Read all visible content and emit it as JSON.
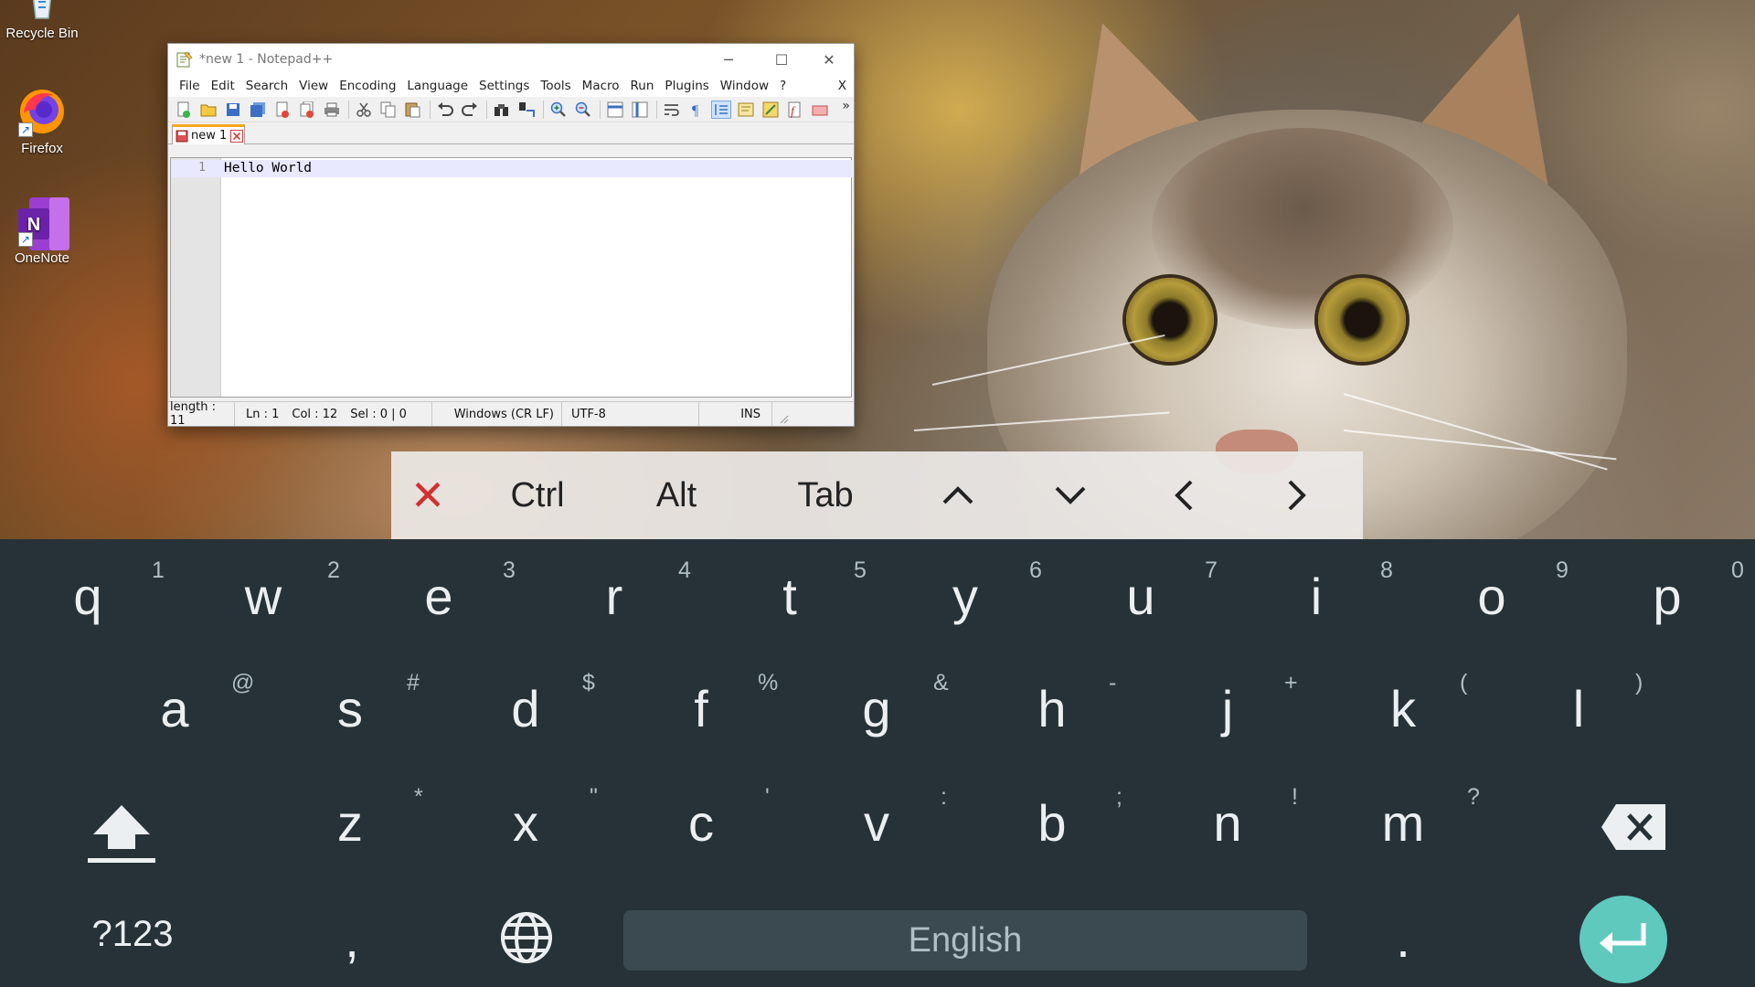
{
  "desktop": {
    "icons": [
      {
        "label": "Recycle Bin",
        "icon": "recycle-bin-icon"
      },
      {
        "label": "Firefox",
        "icon": "firefox-icon"
      },
      {
        "label": "OneNote",
        "icon": "onenote-icon"
      }
    ]
  },
  "notepad": {
    "title": "*new 1 - Notepad++",
    "window_controls": {
      "minimize": "─",
      "maximize": "☐",
      "close": "✕"
    },
    "menu": [
      "File",
      "Edit",
      "Search",
      "View",
      "Encoding",
      "Language",
      "Settings",
      "Tools",
      "Macro",
      "Run",
      "Plugins",
      "Window",
      "?"
    ],
    "menu_close": "X",
    "toolbar_overflow": "»",
    "tab": {
      "label": "new 1"
    },
    "editor": {
      "line_number": "1",
      "text": "Hello World"
    },
    "status": {
      "length": "length : 11",
      "ln": "Ln : 1",
      "col": "Col : 12",
      "sel": "Sel : 0 | 0",
      "eol": "Windows (CR LF)",
      "encoding": "UTF-8",
      "mode": "INS"
    }
  },
  "extra_keys": {
    "close_glyph": "✕",
    "ctrl": "Ctrl",
    "alt": "Alt",
    "tab": "Tab",
    "up": "up-arrow-icon",
    "down": "down-arrow-icon",
    "left": "left-arrow-icon",
    "right": "right-arrow-icon",
    "close_color": "#d32f2f"
  },
  "keyboard": {
    "row1": [
      {
        "key": "q",
        "hint": "1"
      },
      {
        "key": "w",
        "hint": "2"
      },
      {
        "key": "e",
        "hint": "3"
      },
      {
        "key": "r",
        "hint": "4"
      },
      {
        "key": "t",
        "hint": "5"
      },
      {
        "key": "y",
        "hint": "6"
      },
      {
        "key": "u",
        "hint": "7"
      },
      {
        "key": "i",
        "hint": "8"
      },
      {
        "key": "o",
        "hint": "9"
      },
      {
        "key": "p",
        "hint": "0"
      }
    ],
    "row2": [
      {
        "key": "a",
        "hint": "@"
      },
      {
        "key": "s",
        "hint": "#"
      },
      {
        "key": "d",
        "hint": "$"
      },
      {
        "key": "f",
        "hint": "%"
      },
      {
        "key": "g",
        "hint": "&"
      },
      {
        "key": "h",
        "hint": "-"
      },
      {
        "key": "j",
        "hint": "+"
      },
      {
        "key": "k",
        "hint": "("
      },
      {
        "key": "l",
        "hint": ")"
      }
    ],
    "row3": [
      {
        "key": "z",
        "hint": "*"
      },
      {
        "key": "x",
        "hint": "\""
      },
      {
        "key": "c",
        "hint": "'"
      },
      {
        "key": "v",
        "hint": ":"
      },
      {
        "key": "b",
        "hint": ";"
      },
      {
        "key": "n",
        "hint": "!"
      },
      {
        "key": "m",
        "hint": "?"
      }
    ],
    "symbols_key": "?123",
    "comma": ",",
    "space_label": "English",
    "period": ".",
    "enter_color": "#5fc9bd"
  }
}
